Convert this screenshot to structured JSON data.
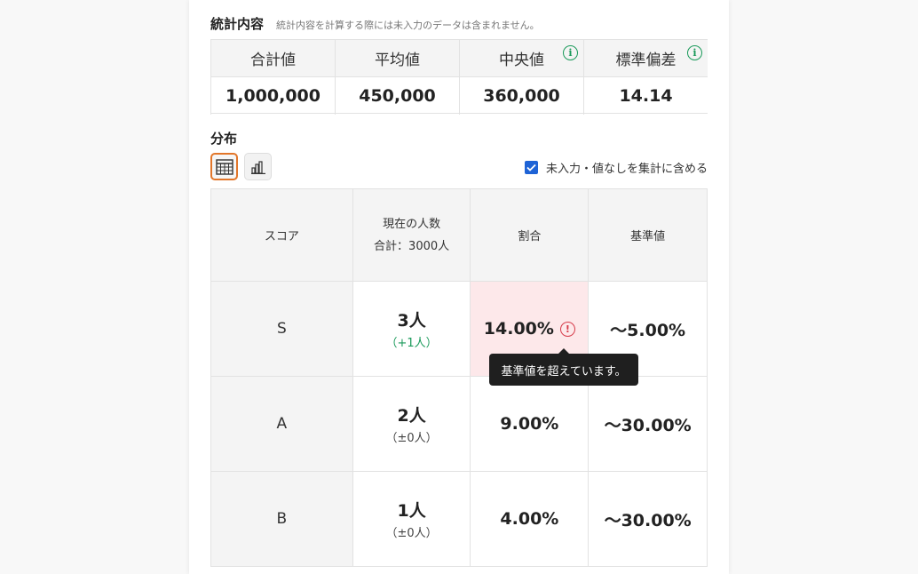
{
  "stats": {
    "title": "統計内容",
    "note": "統計内容を計算する際には未入力のデータは含まれません。",
    "columns": [
      {
        "label": "合計値",
        "value": "1,000,000",
        "info": false
      },
      {
        "label": "平均値",
        "value": "450,000",
        "info": false
      },
      {
        "label": "中央値",
        "value": "360,000",
        "info": true
      },
      {
        "label": "標準偏差",
        "value": "14.14",
        "info": true
      }
    ],
    "info_icon_glyph": "i"
  },
  "distribution": {
    "title": "分布",
    "views": [
      {
        "name": "table-view-icon",
        "active": true
      },
      {
        "name": "bar-chart-view-icon",
        "active": false
      }
    ],
    "include_blank_label": "未入力・値なしを集計に含める",
    "include_blank_checked": true,
    "check_glyph": "✓"
  },
  "table": {
    "headers": {
      "score": "スコア",
      "count_line1": "現在の人数",
      "count_line2": "合計：3000人",
      "ratio": "割合",
      "standard": "基準値"
    },
    "rows": [
      {
        "score": "S",
        "count": "3人",
        "diff": "（+1人）",
        "diff_up": true,
        "ratio": "14.00%",
        "over": true,
        "standard": "〜5.00%"
      },
      {
        "score": "A",
        "count": "2人",
        "diff": "（±0人）",
        "diff_up": false,
        "ratio": "9.00%",
        "over": false,
        "standard": "〜30.00%"
      },
      {
        "score": "B",
        "count": "1人",
        "diff": "（±0人）",
        "diff_up": false,
        "ratio": "4.00%",
        "over": false,
        "standard": "〜30.00%"
      }
    ],
    "warn_glyph": "!",
    "tooltip": "基準値を超えています。"
  },
  "colors": {
    "accent_orange": "#e2762a",
    "success_green": "#1a9a5a",
    "warning_red": "#d63b4a",
    "checkbox_blue": "#1e63d6"
  }
}
